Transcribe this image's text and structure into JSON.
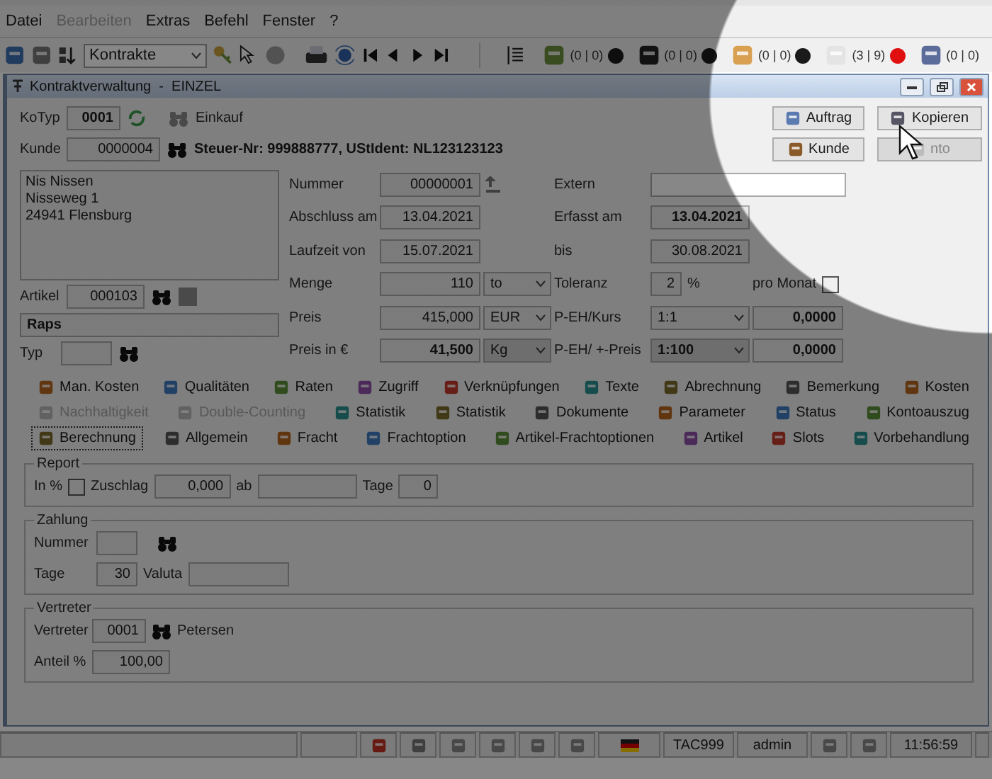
{
  "menu": [
    {
      "label": "Datei",
      "disabled": false
    },
    {
      "label": "Bearbeiten",
      "disabled": true
    },
    {
      "label": "Extras",
      "disabled": false
    },
    {
      "label": "Befehl",
      "disabled": false
    },
    {
      "label": "Fenster",
      "disabled": false
    },
    {
      "label": "?",
      "disabled": false
    }
  ],
  "toolbar": {
    "selector": "Kontrakte",
    "counters": [
      {
        "text": "(0 | 0)",
        "color": "#1a1a1a"
      },
      {
        "text": "(0 | 0)",
        "color": "#1a1a1a"
      },
      {
        "text": "(0 | 0)",
        "color": "#1a1a1a"
      },
      {
        "text": "(3 | 9)",
        "color": "#e01010"
      },
      {
        "text": "(0 | 0)"
      }
    ]
  },
  "window": {
    "title": "Kontraktverwaltung  -  EINZEL"
  },
  "kotyp": {
    "label": "KoTyp",
    "value": "0001",
    "type": "Einkauf"
  },
  "kunde": {
    "label": "Kunde",
    "value": "0000004",
    "tax_info": "Steuer-Nr: 999888777, UStIdent: NL123123123"
  },
  "buttons": [
    {
      "label": "Auftrag",
      "disabled": false
    },
    {
      "label": "Kopieren",
      "disabled": false
    },
    {
      "label": "Kunde",
      "disabled": false
    },
    {
      "label": "nto",
      "disabled": true
    }
  ],
  "address": [
    "Nis Nissen",
    "Nisseweg 1",
    "24941 Flensburg"
  ],
  "artikel": {
    "label": "Artikel",
    "value": "000103",
    "name": "Raps"
  },
  "typ": {
    "label": "Typ"
  },
  "rows": [
    {
      "left": {
        "kind": "counter",
        "label": "Nummer",
        "value": "00000001"
      },
      "right": {
        "kind": "wide",
        "label": "Extern",
        "editable": true
      }
    },
    {
      "left": {
        "kind": "field",
        "label": "Abschluss am",
        "value": "13.04.2021"
      },
      "right": {
        "kind": "field",
        "label": "Erfasst am",
        "value": "13.04.2021",
        "bold": true
      }
    },
    {
      "left": {
        "kind": "field",
        "label": "Laufzeit von",
        "value": "15.07.2021"
      },
      "right": {
        "kind": "field",
        "label": "bis",
        "value": "30.08.2021"
      }
    },
    {
      "left": {
        "kind": "field",
        "label": "Menge",
        "value": "110",
        "unit": {
          "value": "to",
          "disabled": false
        }
      },
      "right": {
        "kind": "tolerance",
        "label": "Toleranz",
        "value": "2",
        "suffix": "%",
        "check": {
          "label": "pro Monat",
          "checked": false
        }
      }
    },
    {
      "left": {
        "kind": "field",
        "label": "Preis",
        "value": "415,000",
        "unit": {
          "value": "EUR",
          "disabled": false
        }
      },
      "right": {
        "kind": "combo",
        "label": "P-EH/Kurs",
        "value": "1:1",
        "disabled": false,
        "extra": "0,0000"
      }
    },
    {
      "left": {
        "kind": "field",
        "label": "Preis in €",
        "value": "41,500",
        "bold": true,
        "unit": {
          "value": "Kg",
          "disabled": true
        }
      },
      "right": {
        "kind": "combo",
        "label": "P-EH/ +-Preis",
        "value": "1:100",
        "disabled": true,
        "extra": "0,0000"
      }
    }
  ],
  "tabs": [
    [
      {
        "label": "Man. Kosten",
        "selected": false,
        "disabled": false
      },
      {
        "label": "Qualitäten",
        "selected": false,
        "disabled": false
      },
      {
        "label": "Raten",
        "selected": false,
        "disabled": false
      },
      {
        "label": "Zugriff",
        "selected": false,
        "disabled": false
      },
      {
        "label": "Verknüpfungen",
        "selected": false,
        "disabled": false
      },
      {
        "label": "Texte",
        "selected": false,
        "disabled": false
      },
      {
        "label": "Abrechnung",
        "selected": false,
        "disabled": false
      },
      {
        "label": "Bemerkung",
        "selected": false,
        "disabled": false
      },
      {
        "label": "Kosten",
        "selected": false,
        "disabled": false
      }
    ],
    [
      {
        "label": "Nachhaltigkeit",
        "selected": false,
        "disabled": true
      },
      {
        "label": "Double-Counting",
        "selected": false,
        "disabled": true
      },
      {
        "label": "Statistik",
        "selected": false,
        "disabled": false
      },
      {
        "label": "Statistik",
        "selected": false,
        "disabled": false
      },
      {
        "label": "Dokumente",
        "selected": false,
        "disabled": false
      },
      {
        "label": "Parameter",
        "selected": false,
        "disabled": false
      },
      {
        "label": "Status",
        "selected": false,
        "disabled": false
      },
      {
        "label": "Kontoauszug",
        "selected": false,
        "disabled": false
      }
    ],
    [
      {
        "label": "Berechnung",
        "selected": true,
        "disabled": false
      },
      {
        "label": "Allgemein",
        "selected": false,
        "disabled": false
      },
      {
        "label": "Fracht",
        "selected": false,
        "disabled": false
      },
      {
        "label": "Frachtoption",
        "selected": false,
        "disabled": false
      },
      {
        "label": "Artikel-Frachtoptionen",
        "selected": false,
        "disabled": false
      },
      {
        "label": "Artikel",
        "selected": false,
        "disabled": false
      },
      {
        "label": "Slots",
        "selected": false,
        "disabled": false
      },
      {
        "label": "Vorbehandlung",
        "selected": false,
        "disabled": false
      }
    ]
  ],
  "report": {
    "title": "Report",
    "in_percent": {
      "label": "In %",
      "checked": false
    },
    "zuschlag": {
      "label": "Zuschlag",
      "value": "0,000"
    },
    "ab": {
      "label": "ab"
    },
    "tage": {
      "label": "Tage",
      "value": "0"
    }
  },
  "zahlung": {
    "title": "Zahlung",
    "nummer": {
      "label": "Nummer"
    },
    "tage": {
      "label": "Tage",
      "value": "30"
    },
    "valuta": {
      "label": "Valuta"
    }
  },
  "vertreter": {
    "title": "Vertreter",
    "vertreter": {
      "label": "Vertreter",
      "value": "0001",
      "name": "Petersen"
    },
    "anteil": {
      "label": "Anteil %",
      "value": "100,00"
    }
  },
  "status_bar": [
    {
      "kind": "blank"
    },
    {
      "kind": "blank"
    },
    {
      "kind": "icon"
    },
    {
      "kind": "icon"
    },
    {
      "kind": "icon"
    },
    {
      "kind": "icon"
    },
    {
      "kind": "icon"
    },
    {
      "kind": "icon"
    },
    {
      "kind": "flag"
    },
    {
      "kind": "text",
      "text": "TAC999"
    },
    {
      "kind": "text",
      "text": "admin"
    },
    {
      "kind": "icon"
    },
    {
      "kind": "icon"
    },
    {
      "kind": "text",
      "text": "11:56:59"
    },
    {
      "kind": "blank"
    }
  ]
}
